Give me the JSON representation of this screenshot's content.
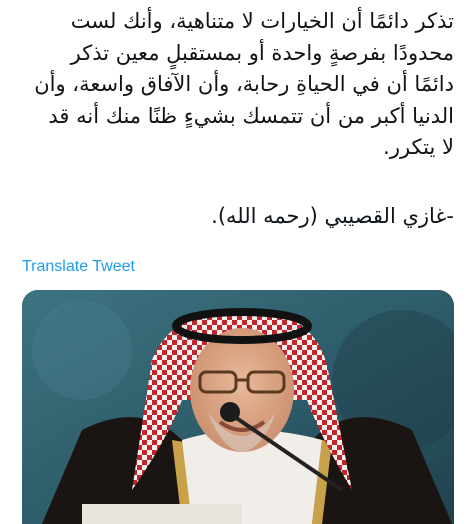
{
  "tweet": {
    "lines": [
      "تذكر دائمًا أن الخيارات لا متناهية، وأنك لست",
      "محدودًا بفرصةٍ واحدة أو بمستقبلٍ معين تذكر",
      "دائمًا أن في الحياةِ رحابة، وأن الآفاق واسعة، وأن",
      "الدنيا أكبر من أن تتمسك بشيءٍ ظنًا منك أنه قد",
      "لا يتكرر."
    ],
    "attribution": "-غازي القصيبي (رحمه الله)."
  },
  "translate_label": "Translate Tweet",
  "media": {
    "alt_subject": "man-portrait-photo"
  }
}
